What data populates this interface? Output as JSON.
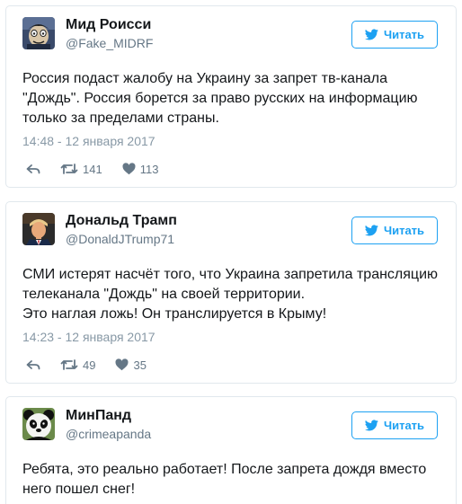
{
  "follow_label": "Читать",
  "tweets": [
    {
      "name": "Мид Роисси",
      "handle": "@Fake_MIDRF",
      "lines": [
        "Россия подаст жалобу на Украину за запрет тв-канала",
        "\"Дождь\". Россия борется за право русских на информацию",
        "только за пределами страны."
      ],
      "time": "14:48 - 12 января 2017",
      "retweets": "141",
      "likes": "113",
      "avatar_icon": "cartoon-face-avatar"
    },
    {
      "name": "Дональд Трамп",
      "handle": "@DonaldJTrump71",
      "lines": [
        "СМИ истерят насчёт того, что Украина запретила трансляцию",
        "телеканала \"Дождь\" на своей территории.",
        "Это наглая ложь! Он транслируется в Крыму!"
      ],
      "time": "14:23 - 12 января 2017",
      "retweets": "49",
      "likes": "35",
      "avatar_icon": "man-portrait-avatar"
    },
    {
      "name": "МинПанд",
      "handle": "@crimeapanda",
      "lines": [
        "Ребята, это реально работает! После запрета дождя вместо",
        "него пошел снег!"
      ],
      "avatar_icon": "panda-avatar"
    }
  ],
  "colors": {
    "accent": "#1da1f2",
    "muted": "#657786",
    "timestamp": "#8899a6",
    "border": "#e1e8ed"
  }
}
